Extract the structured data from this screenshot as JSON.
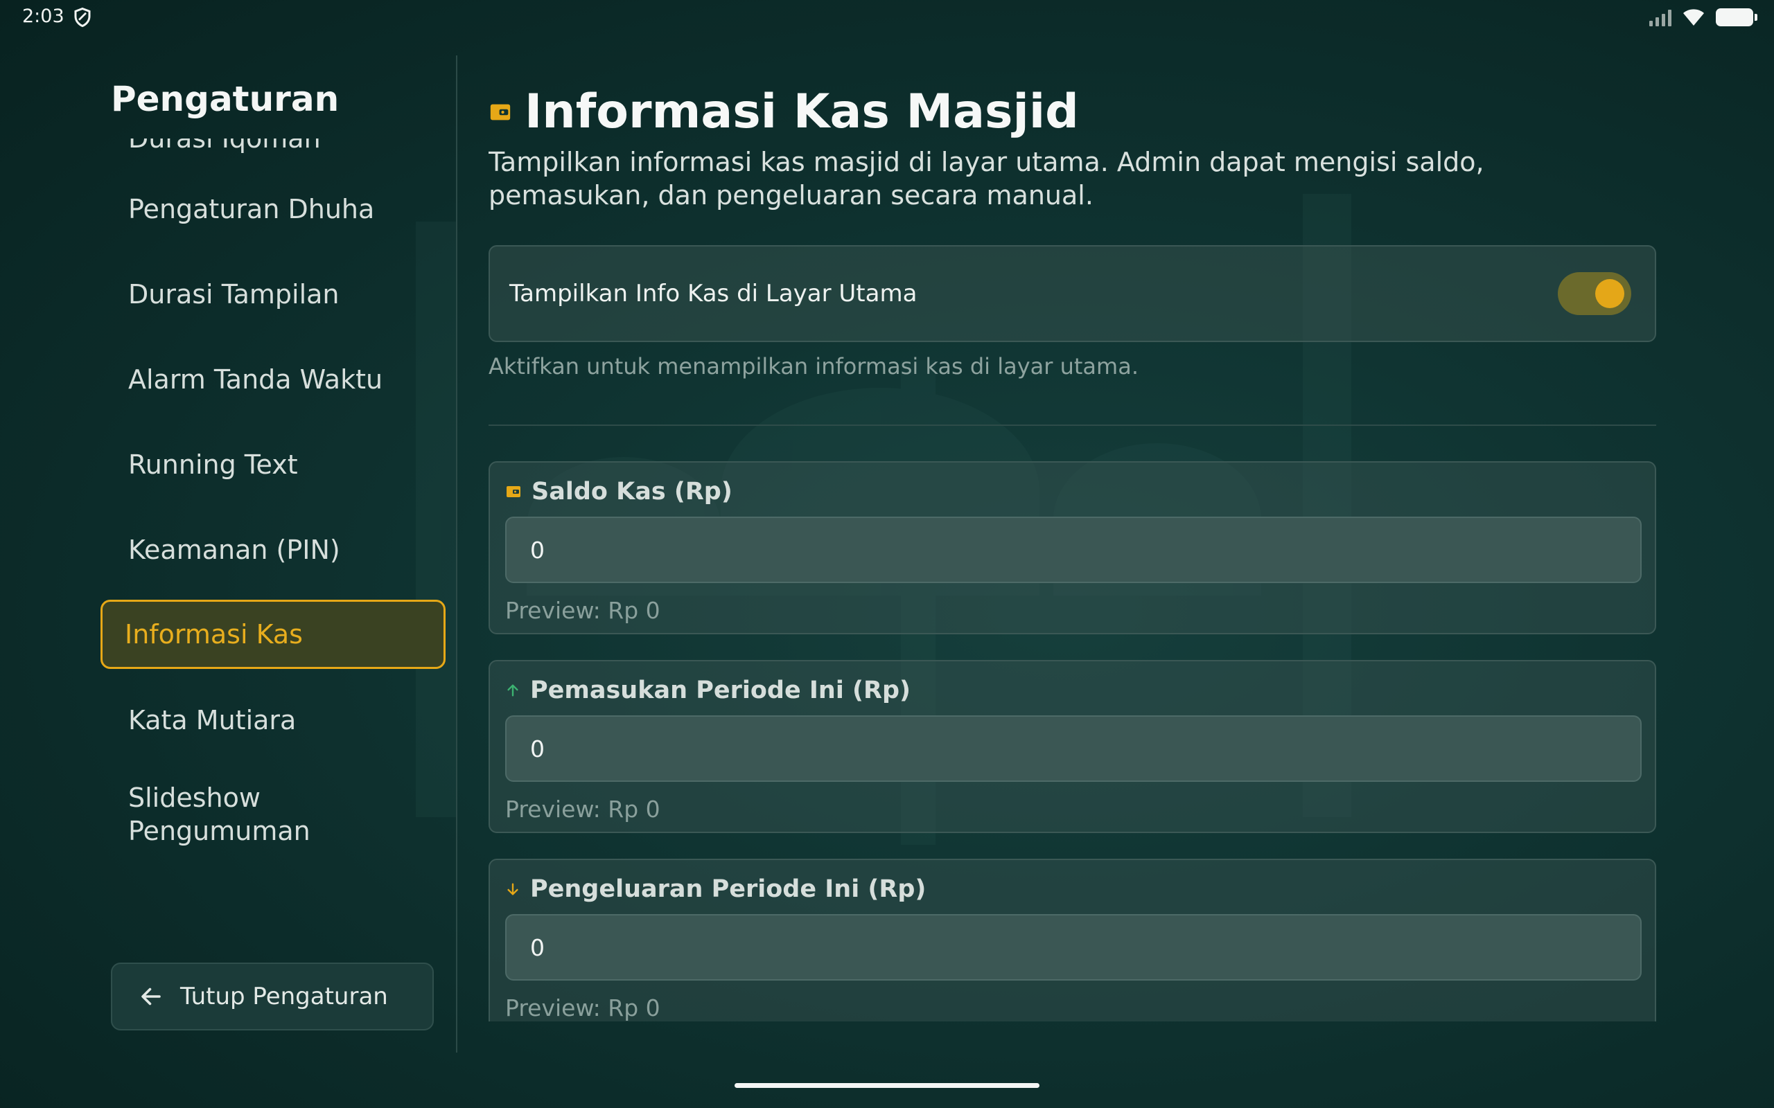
{
  "status_bar": {
    "time": "2:03"
  },
  "sidebar": {
    "title": "Pengaturan",
    "items": [
      {
        "label": "Durasi Iqomah"
      },
      {
        "label": "Pengaturan Dhuha"
      },
      {
        "label": "Durasi Tampilan"
      },
      {
        "label": "Alarm Tanda Waktu"
      },
      {
        "label": "Running Text"
      },
      {
        "label": "Keamanan (PIN)"
      },
      {
        "label": "Informasi Kas"
      },
      {
        "label": "Kata Mutiara"
      },
      {
        "label": "Slideshow Pengumuman"
      }
    ],
    "active_index": 6,
    "close_label": "Tutup Pengaturan"
  },
  "main": {
    "title": "Informasi Kas Masjid",
    "description": "Tampilkan informasi kas masjid di layar utama. Admin dapat mengisi saldo, pemasukan, dan pengeluaran secara manual.",
    "toggle": {
      "label": "Tampilkan Info Kas di Layar Utama",
      "enabled": true,
      "hint": "Aktifkan untuk menampilkan informasi kas di layar utama."
    },
    "fields": [
      {
        "label": "Saldo Kas (Rp)",
        "value": "0",
        "preview": "Preview: Rp 0",
        "icon": "wallet-icon"
      },
      {
        "label": "Pemasukan Periode Ini (Rp)",
        "value": "0",
        "preview": "Preview: Rp 0",
        "icon": "arrow-up-icon"
      },
      {
        "label": "Pengeluaran Periode Ini (Rp)",
        "value": "0",
        "preview": "Preview: Rp 0",
        "icon": "arrow-down-icon"
      }
    ]
  },
  "colors": {
    "accent": "#e6a817",
    "income": "#3cb371",
    "expense": "#e6a817",
    "background": "#0f3331"
  }
}
